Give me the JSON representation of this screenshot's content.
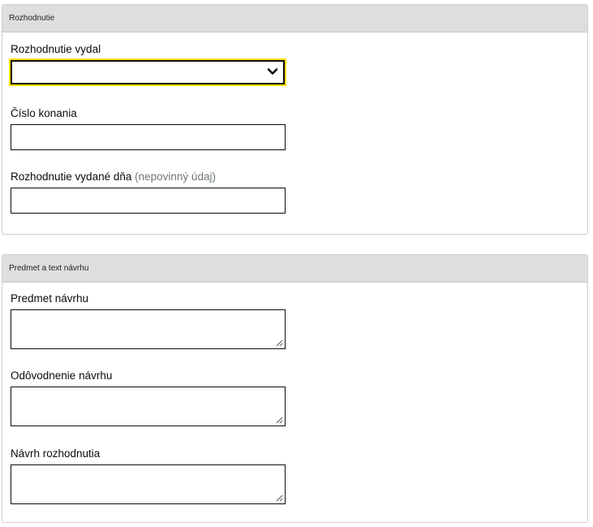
{
  "section_decision": {
    "header": "Rozhodnutie",
    "issued_by_label": "Rozhodnutie vydal",
    "issued_by_value": "",
    "case_number_label": "Číslo konania",
    "case_number_value": "",
    "issued_on_label": "Rozhodnutie vydané dňa",
    "issued_on_hint": "(nepovinný údaj)",
    "issued_on_value": ""
  },
  "section_subject": {
    "header": "Predmet a text návrhu",
    "subject_label": "Predmet návrhu",
    "justification_label": "Odôvodnenie návrhu",
    "draft_decision_label": "Návrh rozhodnutia"
  },
  "colors": {
    "header_bg": "#dedede",
    "focus_ring": "#ffdd00",
    "border": "#0b0c0c",
    "hint": "#6f777b"
  }
}
